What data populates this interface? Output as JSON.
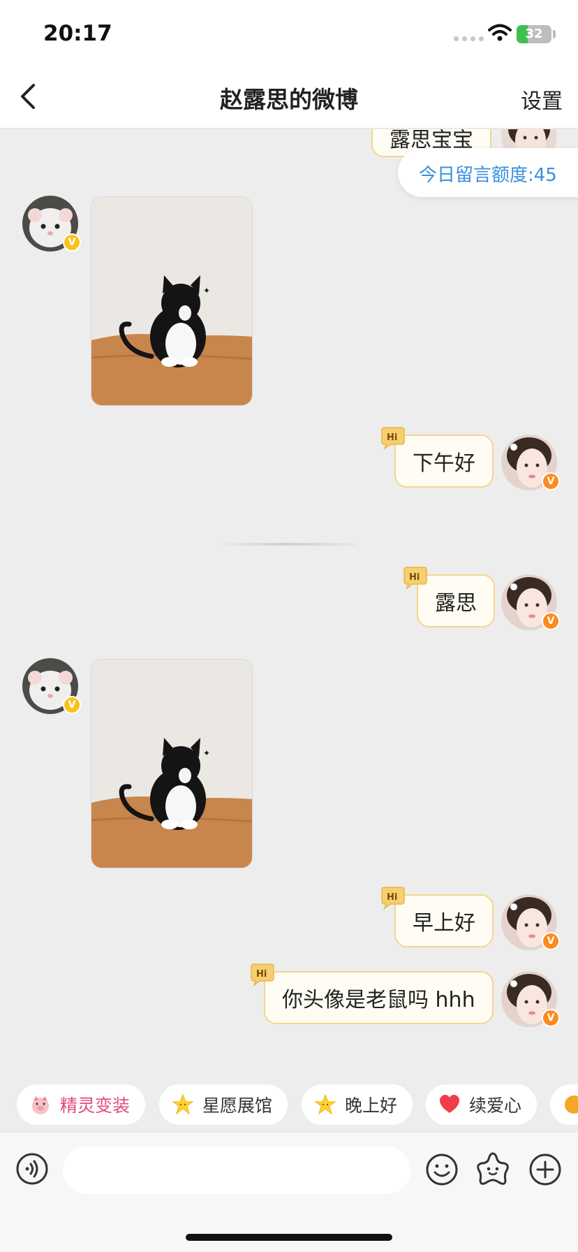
{
  "status_bar": {
    "time": "20:17",
    "battery": "32",
    "battery_level_percent": 32
  },
  "nav": {
    "title": "赵露思的微博",
    "settings_label": "设置",
    "back_icon": "chevron-left-icon"
  },
  "quota": {
    "label": "今日留言额度:45"
  },
  "messages": [
    {
      "side": "right",
      "kind": "text",
      "text": "露思宝宝",
      "partial": true
    },
    {
      "side": "left",
      "kind": "image",
      "content": "cat-photo"
    },
    {
      "side": "right",
      "kind": "text",
      "text": "下午好"
    },
    {
      "side": "right",
      "kind": "text",
      "text": "露思"
    },
    {
      "side": "left",
      "kind": "image",
      "content": "cat-photo"
    },
    {
      "side": "right",
      "kind": "text",
      "text": "早上好"
    },
    {
      "side": "right",
      "kind": "text",
      "text": "你头像是老鼠吗 hhh"
    }
  ],
  "badges": {
    "hi": "Hi",
    "verified": "V"
  },
  "quick_replies": [
    {
      "label": "精灵变装",
      "icon": "pig-sprite-icon"
    },
    {
      "label": "星愿展馆",
      "icon": "star-icon"
    },
    {
      "label": "晚上好",
      "icon": "star-icon"
    },
    {
      "label": "续爱心",
      "icon": "heart-icon"
    }
  ],
  "input": {
    "placeholder": "",
    "value": ""
  },
  "colors": {
    "accent_blue": "#3a8fe0",
    "bubble_border": "#f4d48f",
    "bubble_bg": "#fffdf3",
    "chip_red": "#e24a78",
    "badge_orange": "#ff8a1e"
  }
}
